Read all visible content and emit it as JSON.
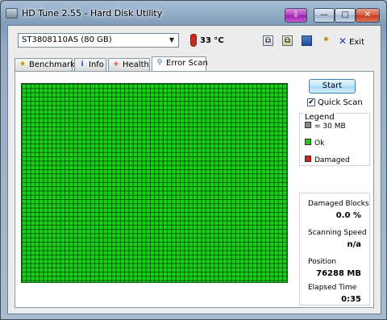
{
  "window": {
    "title": "HD Tune 2.55 - Hard Disk Utility",
    "controls": {
      "minimize": "—",
      "maximize": "□",
      "close": "✕"
    }
  },
  "toolbar": {
    "drive": "ST3808110AS (80 GB)",
    "temperature": "33 °C",
    "exit_label": "Exit"
  },
  "tabs": [
    {
      "label": "Benchmark",
      "icon": "benchmark-icon",
      "active": false
    },
    {
      "label": "Info",
      "icon": "info-icon",
      "active": false
    },
    {
      "label": "Health",
      "icon": "health-icon",
      "active": false
    },
    {
      "label": "Error Scan",
      "icon": "error-scan-icon",
      "active": true
    }
  ],
  "scan": {
    "start_label": "Start",
    "quick_scan_label": "Quick Scan",
    "quick_scan_checked": true
  },
  "legend": {
    "title": "Legend",
    "items": [
      {
        "label": "= 30 MB",
        "color": "#888888"
      },
      {
        "label": "Ok",
        "color": "#18d118"
      },
      {
        "label": "Damaged",
        "color": "#d42020"
      }
    ]
  },
  "stats": {
    "damaged_blocks_label": "Damaged Blocks",
    "damaged_blocks_value": "0.0 %",
    "scanning_speed_label": "Scanning Speed",
    "scanning_speed_value": "n/a",
    "position_label": "Position",
    "position_value": "76288 MB",
    "elapsed_label": "Elapsed Time",
    "elapsed_value": "0:35"
  },
  "colors": {
    "ok": "#18d118",
    "grid_line": "#0e3a0e"
  }
}
